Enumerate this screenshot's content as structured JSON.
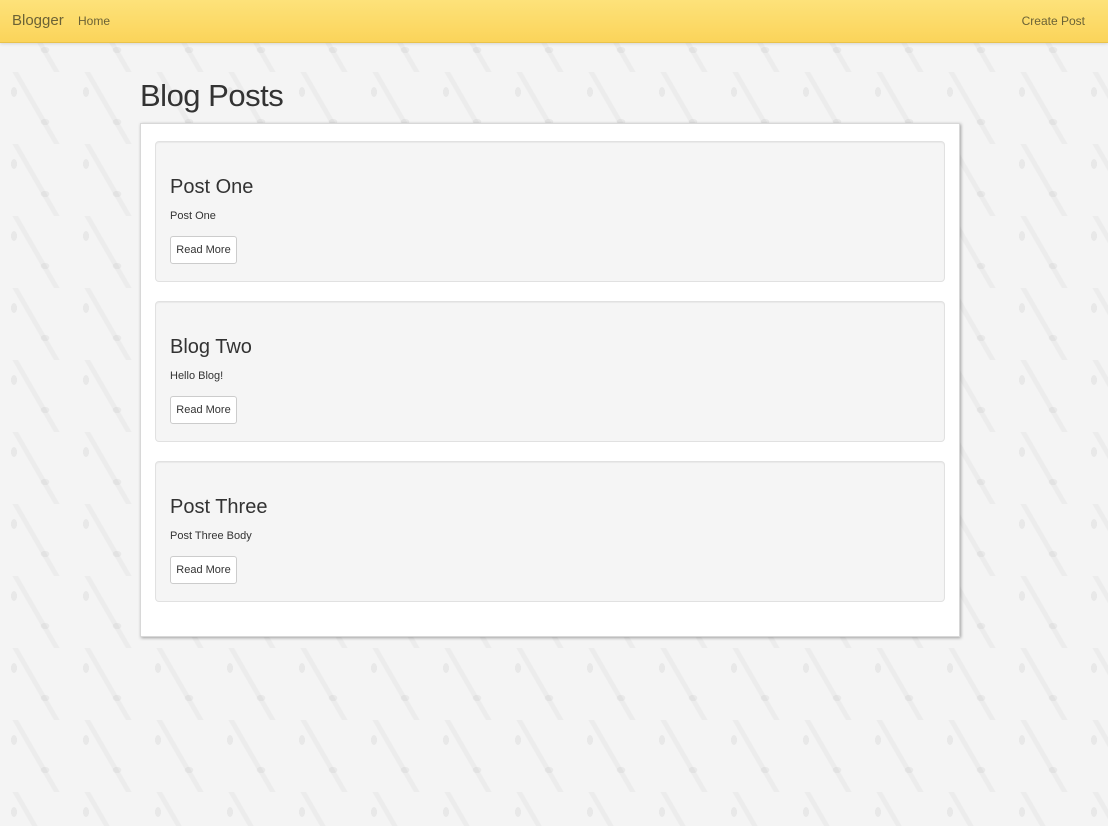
{
  "navbar": {
    "brand": "Blogger",
    "home_label": "Home",
    "create_label": "Create Post"
  },
  "page": {
    "title": "Blog Posts"
  },
  "posts": [
    {
      "title": "Post One",
      "body": "Post One",
      "button_label": "Read More"
    },
    {
      "title": "Blog Two",
      "body": "Hello Blog!",
      "button_label": "Read More"
    },
    {
      "title": "Post Three",
      "body": "Post Three Body",
      "button_label": "Read More"
    }
  ],
  "colors": {
    "navbar": "#fbd45a",
    "background": "#f4f4f4",
    "card": "#f5f5f5"
  }
}
